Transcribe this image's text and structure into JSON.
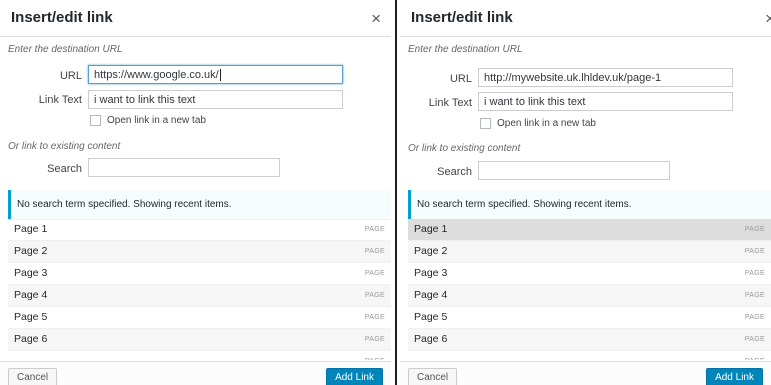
{
  "left": {
    "title": "Insert/edit link",
    "close": "×",
    "hint_url": "Enter the destination URL",
    "url_label": "URL",
    "url_value": "https://www.google.co.uk/",
    "text_label": "Link Text",
    "text_value": "i want to link this text",
    "new_tab_label": "Open link in a new tab",
    "hint_existing": "Or link to existing content",
    "search_label": "Search",
    "search_value": "",
    "notice": "No search term specified. Showing recent items.",
    "items": [
      {
        "title": "Page 1",
        "type": "PAGE"
      },
      {
        "title": "Page 2",
        "type": "PAGE"
      },
      {
        "title": "Page 3",
        "type": "PAGE"
      },
      {
        "title": "Page 4",
        "type": "PAGE"
      },
      {
        "title": "Page 5",
        "type": "PAGE"
      },
      {
        "title": "Page 6",
        "type": "PAGE"
      },
      {
        "title": "",
        "type": "PAGE"
      }
    ],
    "cancel": "Cancel",
    "add_link": "Add Link"
  },
  "right": {
    "title": "Insert/edit link",
    "close": "×",
    "hint_url": "Enter the destination URL",
    "url_label": "URL",
    "url_value": "http://mywebsite.uk.lhldev.uk/page-1",
    "text_label": "Link Text",
    "text_value": "i want to link this text",
    "new_tab_label": "Open link in a new tab",
    "hint_existing": "Or link to existing content",
    "search_label": "Search",
    "search_value": "",
    "notice": "No search term specified. Showing recent items.",
    "items": [
      {
        "title": "Page 1",
        "type": "PAGE"
      },
      {
        "title": "Page 2",
        "type": "PAGE"
      },
      {
        "title": "Page 3",
        "type": "PAGE"
      },
      {
        "title": "Page 4",
        "type": "PAGE"
      },
      {
        "title": "Page 5",
        "type": "PAGE"
      },
      {
        "title": "Page 6",
        "type": "PAGE"
      },
      {
        "title": "",
        "type": "PAGE"
      }
    ],
    "cancel": "Cancel",
    "add_link": "Add Link"
  },
  "colors": {
    "accent": "#0085ba",
    "notice_border": "#00a0d2",
    "selected_row": "#dddddd"
  }
}
